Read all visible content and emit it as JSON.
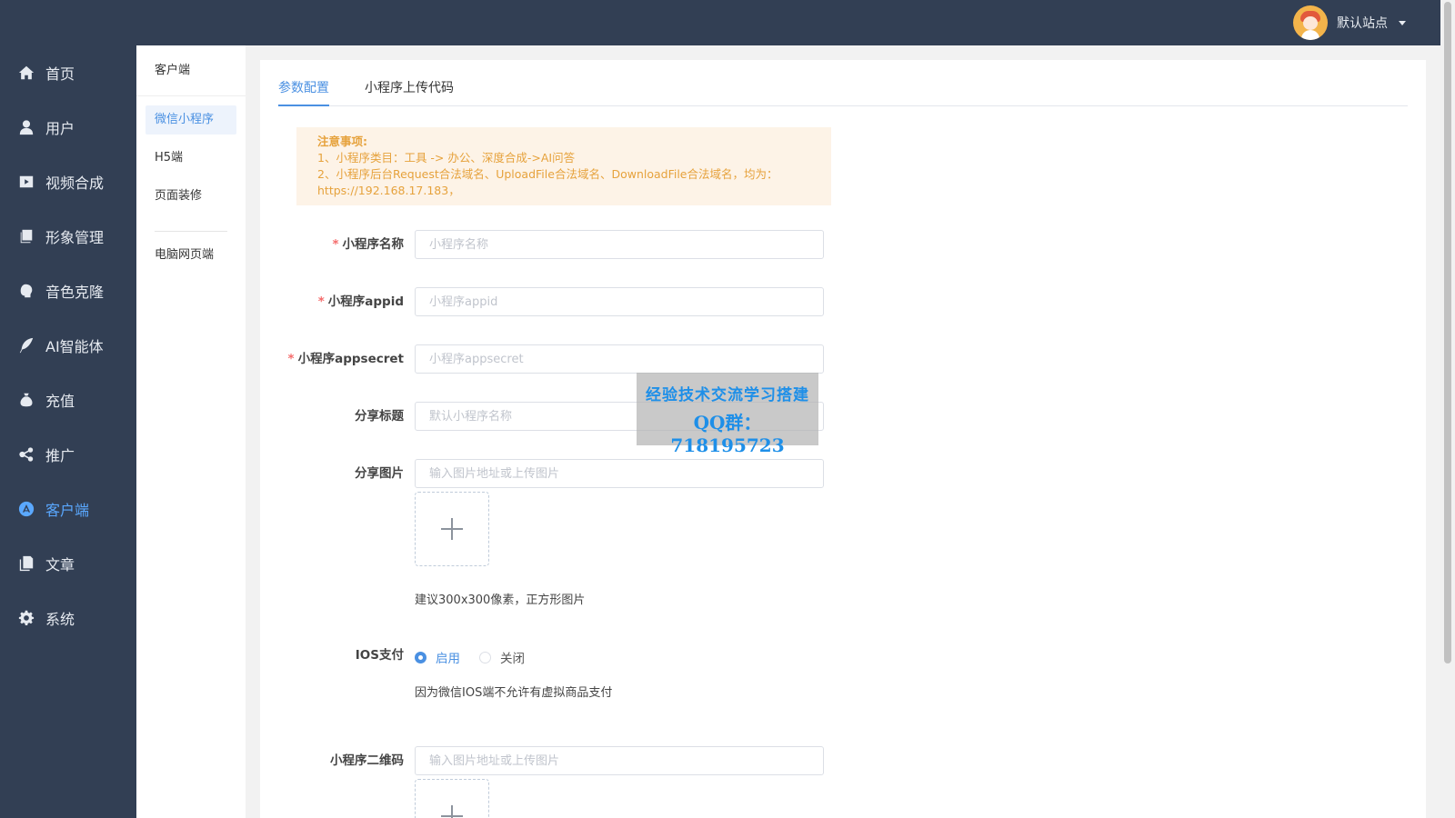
{
  "header": {
    "site_name": "默认站点"
  },
  "sidebar": {
    "items": [
      {
        "label": "首页",
        "icon": "home-icon"
      },
      {
        "label": "用户",
        "icon": "user-icon"
      },
      {
        "label": "视频合成",
        "icon": "video-icon"
      },
      {
        "label": "形象管理",
        "icon": "image-icon"
      },
      {
        "label": "音色克隆",
        "icon": "voice-icon"
      },
      {
        "label": "AI智能体",
        "icon": "feather-icon"
      },
      {
        "label": "充值",
        "icon": "money-bag-icon"
      },
      {
        "label": "推广",
        "icon": "share-icon"
      },
      {
        "label": "客户端",
        "icon": "app-store-icon",
        "active": true
      },
      {
        "label": "文章",
        "icon": "document-icon"
      },
      {
        "label": "系统",
        "icon": "gear-icon"
      }
    ]
  },
  "subnav": {
    "title": "客户端",
    "items": [
      "微信小程序",
      "H5端",
      "页面装修"
    ],
    "extra": "电脑网页端"
  },
  "tabs": [
    "参数配置",
    "小程序上传代码"
  ],
  "notice": {
    "title": "注意事项:",
    "line1": "1、小程序类目：工具 -> 办公、深度合成->AI问答",
    "line2": "2、小程序后台Request合法域名、UploadFile合法域名、DownloadFile合法域名，均为：",
    "line3": "https://192.168.17.183，"
  },
  "form": {
    "name": {
      "label": "小程序名称",
      "placeholder": "小程序名称",
      "required": "*"
    },
    "appid": {
      "label": "小程序appid",
      "placeholder": "小程序appid",
      "required": "*"
    },
    "appsecret": {
      "label": "小程序appsecret",
      "placeholder": "小程序appsecret",
      "required": "*"
    },
    "share_title": {
      "label": "分享标题",
      "placeholder": "默认小程序名称"
    },
    "share_image": {
      "label": "分享图片",
      "placeholder": "输入图片地址或上传图片",
      "hint": "建议300x300像素，正方形图片"
    },
    "ios_pay": {
      "label": "IOS支付",
      "on": "启用",
      "off": "关闭",
      "hint": "因为微信IOS端不允许有虚拟商品支付"
    },
    "qrcode": {
      "label": "小程序二维码",
      "placeholder": "输入图片地址或上传图片"
    }
  },
  "watermark": {
    "line1": "经验技术交流学习搭建",
    "line2": "QQ群：718195723"
  },
  "colors": {
    "sidebar": "#323f54",
    "accent": "#4a90e2",
    "notice_bg": "#fdf3e7",
    "notice_text": "#e6a23c",
    "required": "#f56c6c"
  }
}
